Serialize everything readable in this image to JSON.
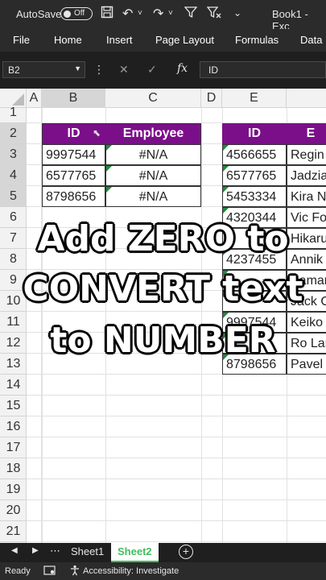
{
  "titlebar": {
    "autosave": "AutoSave",
    "toggle": "Off",
    "doc_title": "Book1 - Exc",
    "icons": [
      "save-icon",
      "undo-icon",
      "redo-icon",
      "filter-icon",
      "clear-filter-icon",
      "more-icon"
    ]
  },
  "ribbon": {
    "tabs": [
      "File",
      "Home",
      "Insert",
      "Page Layout",
      "Formulas",
      "Data"
    ]
  },
  "formula_bar": {
    "name_box": "B2",
    "fx": "fx",
    "value": "ID"
  },
  "columns": [
    "A",
    "B",
    "C",
    "D",
    "E"
  ],
  "rows": [
    "1",
    "2",
    "3",
    "4",
    "5",
    "6",
    "7",
    "8",
    "9",
    "10",
    "11",
    "12",
    "13",
    "14",
    "15",
    "16",
    "17",
    "18",
    "19",
    "20",
    "21"
  ],
  "table1": {
    "headers": [
      "ID",
      "Employee"
    ],
    "rows": [
      [
        "9997544",
        "#N/A"
      ],
      [
        "6577765",
        "#N/A"
      ],
      [
        "8798656",
        "#N/A"
      ]
    ]
  },
  "table2": {
    "headers": [
      "ID",
      "E"
    ],
    "rows": [
      [
        "4566655",
        "Regin"
      ],
      [
        "6577765",
        "Jadzia"
      ],
      [
        "5453334",
        "Kira N"
      ],
      [
        "4320344",
        "Vic Fo"
      ],
      [
        "",
        "Hikaru"
      ],
      [
        "4237455",
        "Annik"
      ],
      [
        "",
        "Kaman"
      ],
      [
        "",
        "Jack O"
      ],
      [
        "9997544",
        "Keiko"
      ],
      [
        "",
        "Ro Lar"
      ],
      [
        "8798656",
        "Pavel"
      ]
    ]
  },
  "caption": [
    "Add ZERO to",
    "CONVERT text",
    "to NUMBER"
  ],
  "sheet_tabs": {
    "tabs": [
      "Sheet1",
      "Sheet2"
    ],
    "active": "Sheet2",
    "add": "+"
  },
  "status": {
    "ready": "Ready",
    "accessibility": "Accessibility: Investigate"
  },
  "colors": {
    "header_fill": "#7b0f8a",
    "active_tab": "#3fbf5c",
    "error_triangle": "#1f8a3b"
  }
}
